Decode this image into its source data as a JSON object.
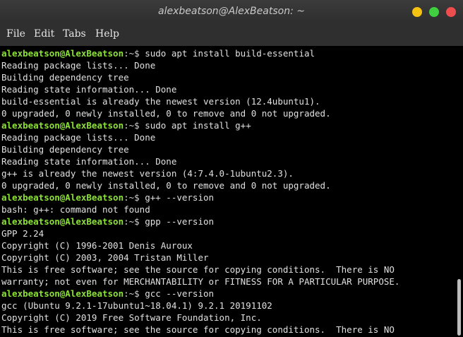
{
  "window": {
    "title": "alexbeatson@AlexBeatson: ~",
    "buttons": [
      {
        "name": "minimize",
        "color": "#f5c211"
      },
      {
        "name": "maximize",
        "color": "#3fcf3f"
      },
      {
        "name": "close",
        "color": "#ed4d4d"
      }
    ]
  },
  "menubar": {
    "items": [
      {
        "label": "File"
      },
      {
        "label": "Edit"
      },
      {
        "label": "Tabs"
      },
      {
        "label": "Help"
      }
    ]
  },
  "colors": {
    "prompt_user": "#8ae234",
    "terminal_bg": "#000000",
    "terminal_fg": "#e0e0e0"
  },
  "terminal": {
    "lines": [
      {
        "type": "prompt",
        "user": "alexbeatson@AlexBeatson",
        "path": ":~$ ",
        "cmd": "sudo apt install build-essential"
      },
      {
        "type": "output",
        "text": "Reading package lists... Done"
      },
      {
        "type": "output",
        "text": "Building dependency tree"
      },
      {
        "type": "output",
        "text": "Reading state information... Done"
      },
      {
        "type": "output",
        "text": "build-essential is already the newest version (12.4ubuntu1)."
      },
      {
        "type": "output",
        "text": "0 upgraded, 0 newly installed, 0 to remove and 0 not upgraded."
      },
      {
        "type": "prompt",
        "user": "alexbeatson@AlexBeatson",
        "path": ":~$ ",
        "cmd": "sudo apt install g++"
      },
      {
        "type": "output",
        "text": "Reading package lists... Done"
      },
      {
        "type": "output",
        "text": "Building dependency tree"
      },
      {
        "type": "output",
        "text": "Reading state information... Done"
      },
      {
        "type": "output",
        "text": "g++ is already the newest version (4:7.4.0-1ubuntu2.3)."
      },
      {
        "type": "output",
        "text": "0 upgraded, 0 newly installed, 0 to remove and 0 not upgraded."
      },
      {
        "type": "prompt",
        "user": "alexbeatson@AlexBeatson",
        "path": ":~$ ",
        "cmd": "g++ --version"
      },
      {
        "type": "output",
        "text": "bash: g++: command not found"
      },
      {
        "type": "prompt",
        "user": "alexbeatson@AlexBeatson",
        "path": ":~$ ",
        "cmd": "gpp --version"
      },
      {
        "type": "output",
        "text": "GPP 2.24"
      },
      {
        "type": "output",
        "text": "Copyright (C) 1996-2001 Denis Auroux"
      },
      {
        "type": "output",
        "text": "Copyright (C) 2003, 2004 Tristan Miller"
      },
      {
        "type": "output",
        "text": "This is free software; see the source for copying conditions.  There is NO"
      },
      {
        "type": "output",
        "text": "warranty; not even for MERCHANTABILITY or FITNESS FOR A PARTICULAR PURPOSE."
      },
      {
        "type": "prompt",
        "user": "alexbeatson@AlexBeatson",
        "path": ":~$ ",
        "cmd": "gcc --version"
      },
      {
        "type": "output",
        "text": "gcc (Ubuntu 9.2.1-17ubuntu1~18.04.1) 9.2.1 20191102"
      },
      {
        "type": "output",
        "text": "Copyright (C) 2019 Free Software Foundation, Inc."
      },
      {
        "type": "output",
        "text": "This is free software; see the source for copying conditions.  There is NO"
      }
    ]
  }
}
